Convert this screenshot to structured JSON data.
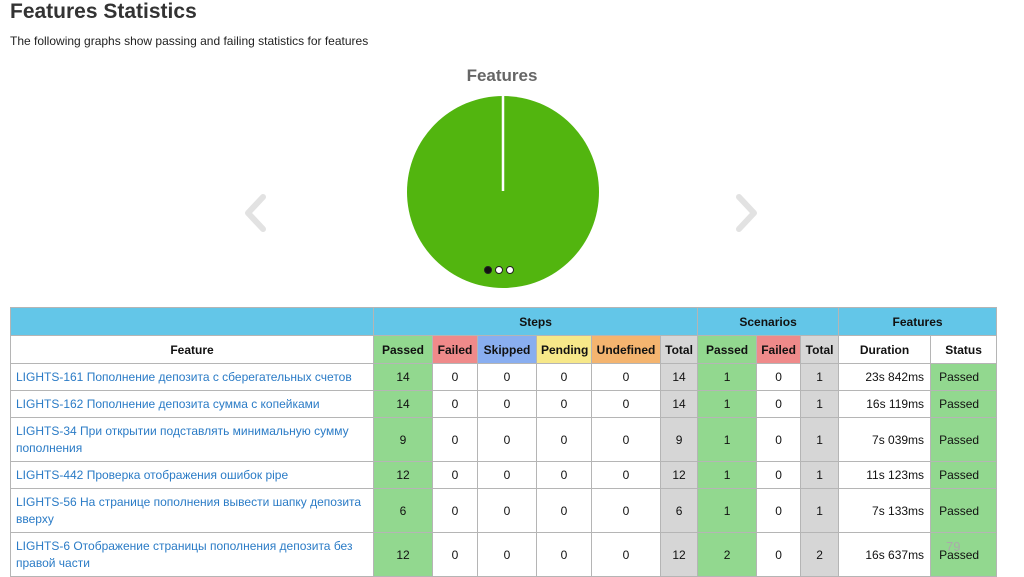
{
  "page": {
    "title": "Features Statistics",
    "description": "The following graphs show passing and failing statistics for features"
  },
  "chart": {
    "title": "Features",
    "colors": {
      "passed": "#52b50f"
    },
    "carousel": {
      "active_index": 0,
      "count": 3
    }
  },
  "table": {
    "groups": {
      "steps": "Steps",
      "scenarios": "Scenarios",
      "features": "Features"
    },
    "columns": {
      "feature": "Feature",
      "steps_passed": "Passed",
      "steps_failed": "Failed",
      "steps_skipped": "Skipped",
      "steps_pending": "Pending",
      "steps_undefined": "Undefined",
      "steps_total": "Total",
      "scen_passed": "Passed",
      "scen_failed": "Failed",
      "scen_total": "Total",
      "duration": "Duration",
      "status": "Status"
    },
    "rows": [
      {
        "feature": "LIGHTS-161 Пополнение депозита с сберегательных счетов",
        "steps_passed": "14",
        "steps_failed": "0",
        "steps_skipped": "0",
        "steps_pending": "0",
        "steps_undefined": "0",
        "steps_total": "14",
        "scen_passed": "1",
        "scen_failed": "0",
        "scen_total": "1",
        "duration": "23s 842ms",
        "status": "Passed"
      },
      {
        "feature": "LIGHTS-162 Пополнение депозита сумма с копейками",
        "steps_passed": "14",
        "steps_failed": "0",
        "steps_skipped": "0",
        "steps_pending": "0",
        "steps_undefined": "0",
        "steps_total": "14",
        "scen_passed": "1",
        "scen_failed": "0",
        "scen_total": "1",
        "duration": "16s 119ms",
        "status": "Passed"
      },
      {
        "feature": "LIGHTS-34 При открытии подставлять минимальную сумму пополнения",
        "steps_passed": "9",
        "steps_failed": "0",
        "steps_skipped": "0",
        "steps_pending": "0",
        "steps_undefined": "0",
        "steps_total": "9",
        "scen_passed": "1",
        "scen_failed": "0",
        "scen_total": "1",
        "duration": "7s 039ms",
        "status": "Passed"
      },
      {
        "feature": "LIGHTS-442 Проверка отображения ошибок pipe",
        "steps_passed": "12",
        "steps_failed": "0",
        "steps_skipped": "0",
        "steps_pending": "0",
        "steps_undefined": "0",
        "steps_total": "12",
        "scen_passed": "1",
        "scen_failed": "0",
        "scen_total": "1",
        "duration": "11s 123ms",
        "status": "Passed"
      },
      {
        "feature": "LIGHTS-56 На странице пополнения вывести шапку депозита вверху",
        "steps_passed": "6",
        "steps_failed": "0",
        "steps_skipped": "0",
        "steps_pending": "0",
        "steps_undefined": "0",
        "steps_total": "6",
        "scen_passed": "1",
        "scen_failed": "0",
        "scen_total": "1",
        "duration": "7s 133ms",
        "status": "Passed"
      },
      {
        "feature": "LIGHTS-6 Отображение страницы пополнения депозита без правой части",
        "steps_passed": "12",
        "steps_failed": "0",
        "steps_skipped": "0",
        "steps_pending": "0",
        "steps_undefined": "0",
        "steps_total": "12",
        "scen_passed": "2",
        "scen_failed": "0",
        "scen_total": "2",
        "duration": "16s 637ms",
        "status": "Passed"
      }
    ]
  },
  "slide_number": "79"
}
